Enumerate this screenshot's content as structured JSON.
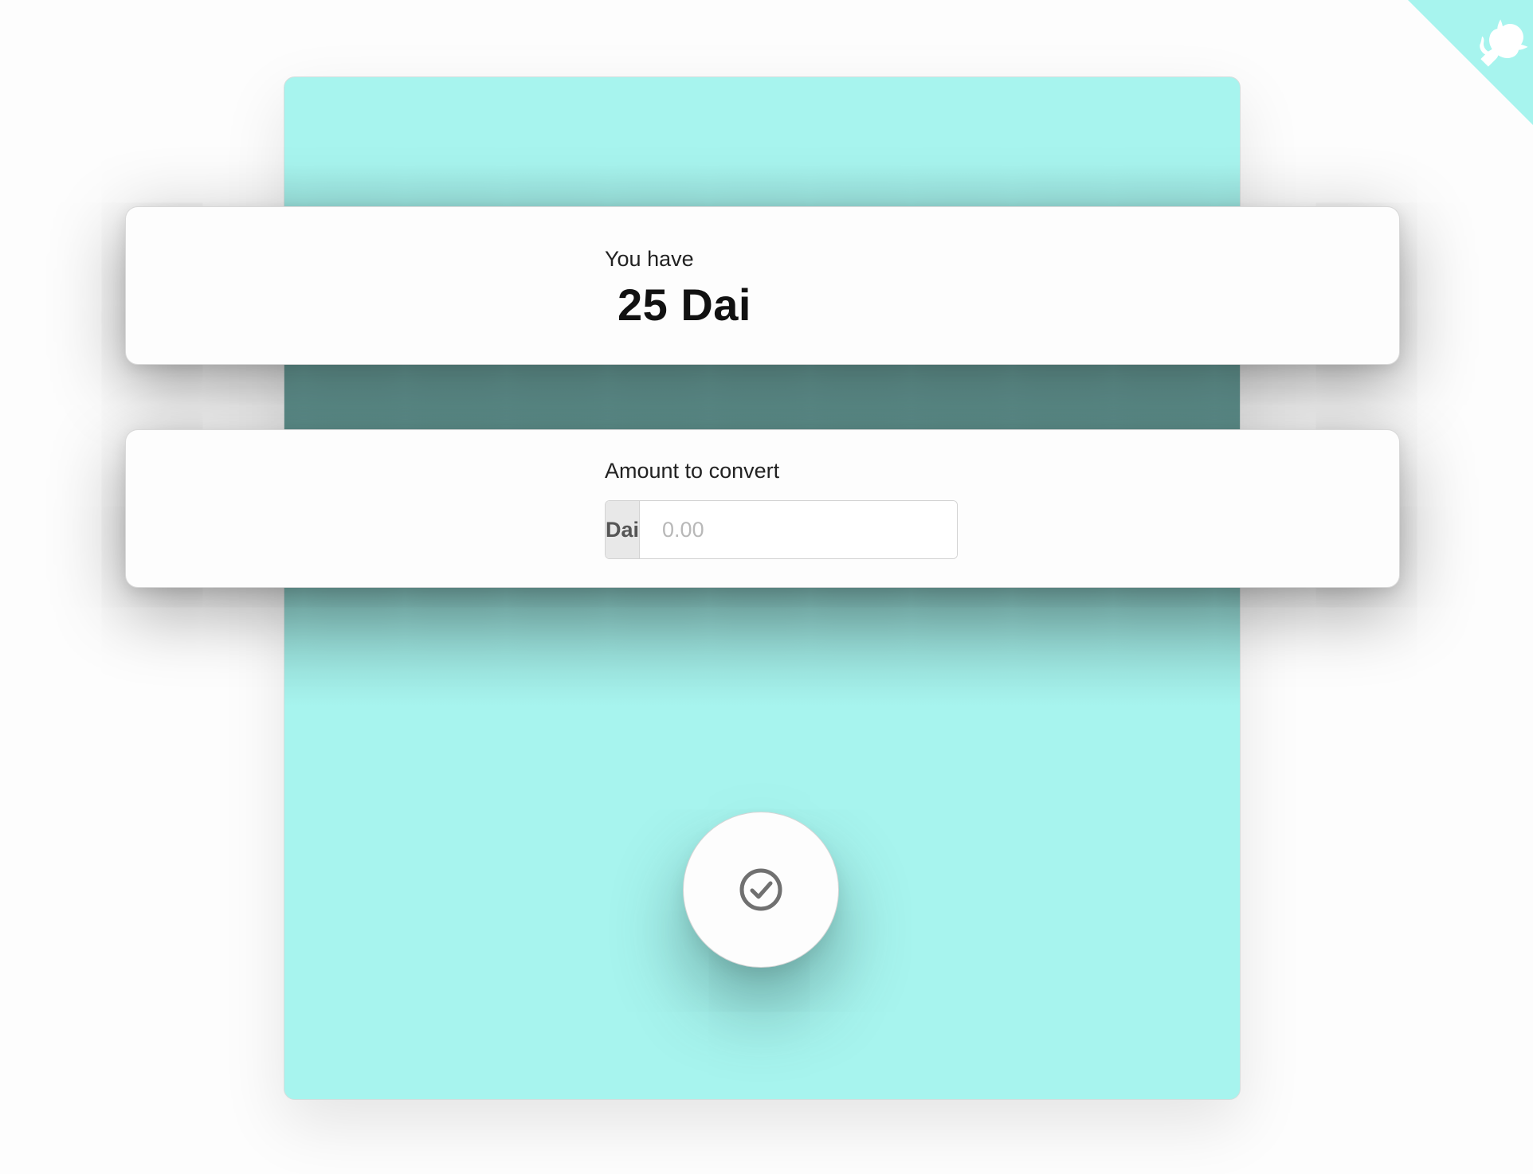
{
  "colors": {
    "panel_background": "#a7f4ee",
    "card_background": "#fdfdfd",
    "page_background": "#fdfdfd",
    "corner_accent": "#a7f4ee",
    "icon_gray": "#707070"
  },
  "github_corner": {
    "icon": "github-octocat-icon"
  },
  "balance_card": {
    "label": "You have",
    "value": "25 Dai"
  },
  "amount_card": {
    "label": "Amount to convert",
    "currency": "Dai",
    "input_placeholder": "0.00",
    "input_value": ""
  },
  "confirm": {
    "icon": "check-circle-icon"
  }
}
